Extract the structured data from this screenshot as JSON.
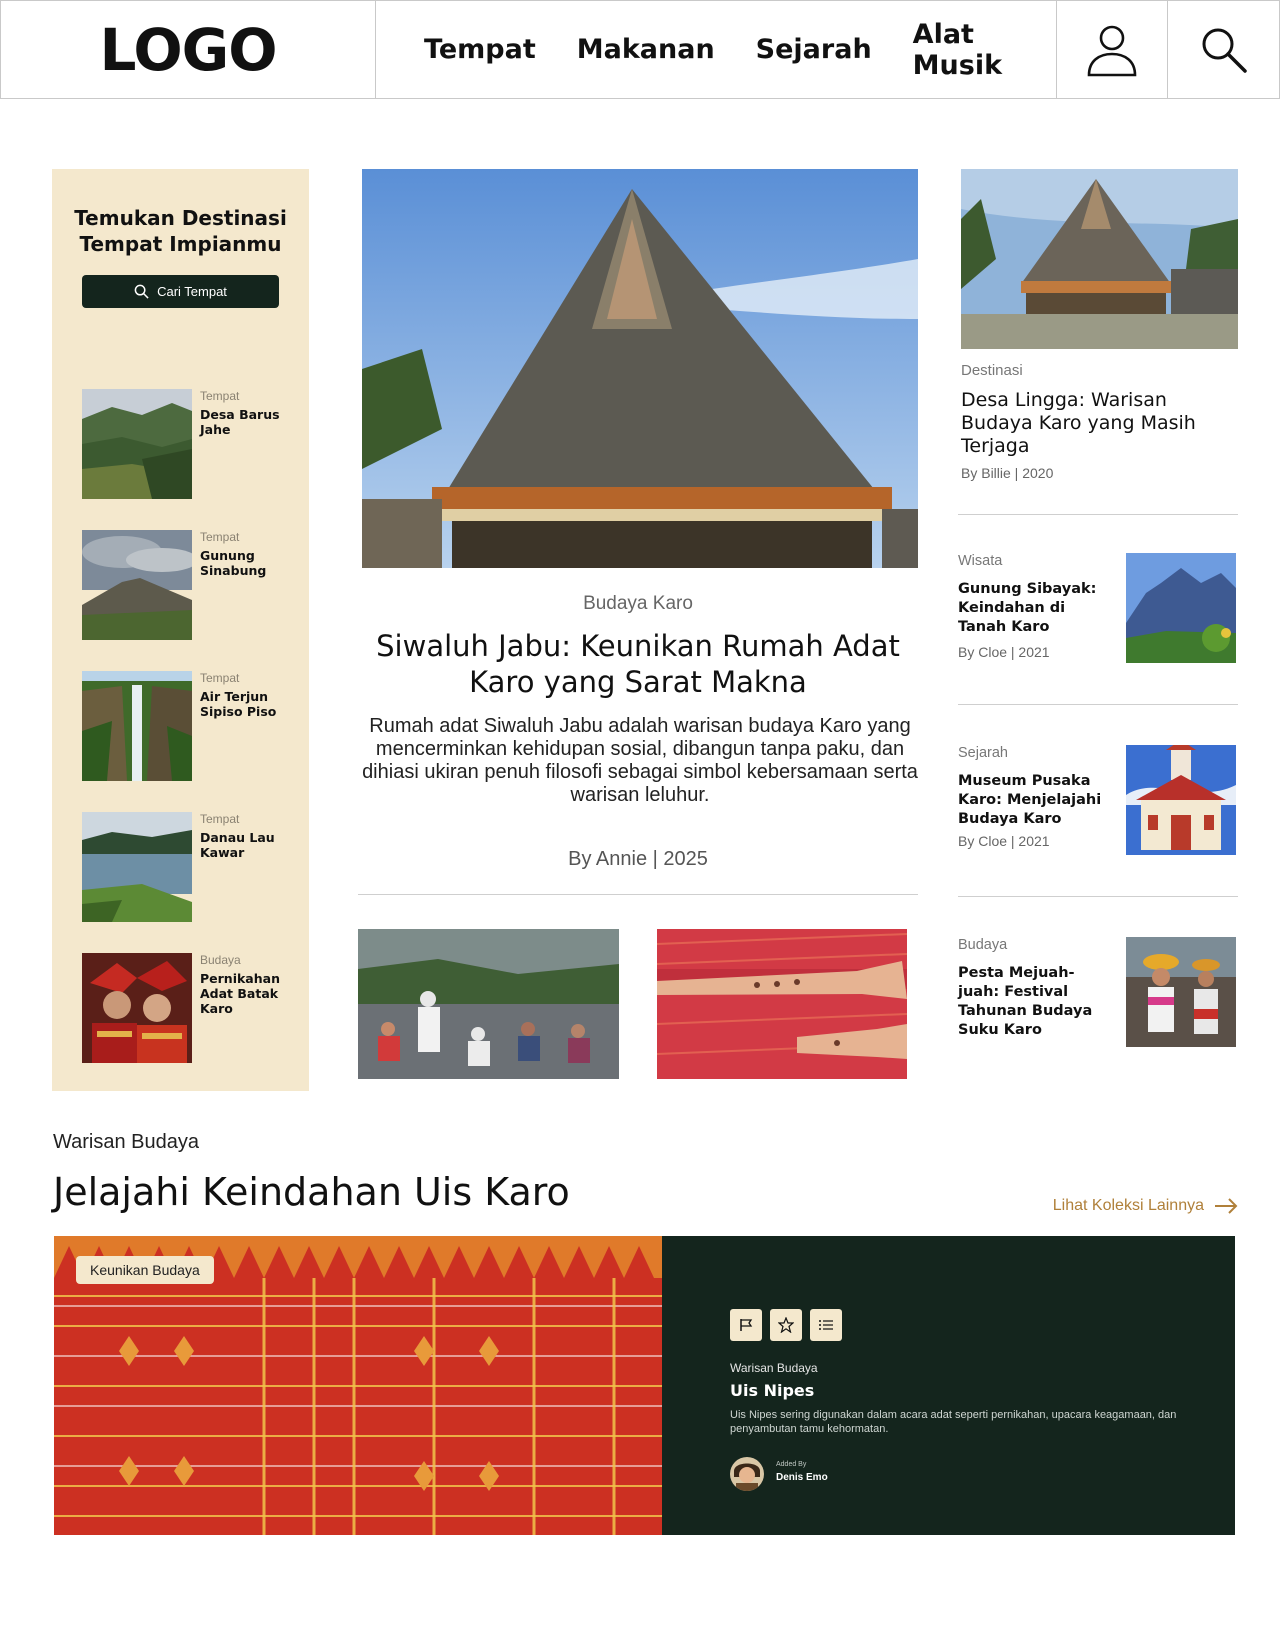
{
  "header": {
    "logo": "LOGO",
    "nav": [
      "Tempat",
      "Makanan",
      "Sejarah",
      "Alat Musik"
    ],
    "profile_icon": "user-icon",
    "search_icon": "search-icon"
  },
  "sidebar": {
    "title_line1": "Temukan Destinasi",
    "title_line2": "Tempat Impianmu",
    "button_label": "Cari Tempat",
    "items": [
      {
        "category": "Tempat",
        "name": "Desa Barus Jahe"
      },
      {
        "category": "Tempat",
        "name": "Gunung Sinabung"
      },
      {
        "category": "Tempat",
        "name": "Air Terjun Sipiso Piso"
      },
      {
        "category": "Tempat",
        "name": "Danau Lau Kawar"
      },
      {
        "category": "Budaya",
        "name": "Pernikahan Adat Batak Karo"
      }
    ]
  },
  "featured": {
    "category": "Budaya Karo",
    "title": "Siwaluh Jabu: Keunikan Rumah Adat Karo yang Sarat Makna",
    "description": "Rumah adat Siwaluh Jabu adalah warisan budaya Karo yang mencerminkan kehidupan sosial, dibangun tanpa paku, dan dihiasi ukiran penuh filosofi sebagai simbol kebersamaan serta warisan leluhur.",
    "byline": "By Annie | 2025"
  },
  "right": {
    "top": {
      "category": "Destinasi",
      "title": "Desa Lingga: Warisan Budaya Karo yang Masih Terjaga",
      "byline": "By Billie | 2020"
    },
    "items": [
      {
        "category": "Wisata",
        "title": "Gunung Sibayak: Keindahan di Tanah Karo",
        "byline": "By Cloe | 2021"
      },
      {
        "category": "Sejarah",
        "title": "Museum Pusaka Karo: Menjelajahi Budaya Karo",
        "byline": "By Cloe | 2021"
      },
      {
        "category": "Budaya",
        "title": "Pesta Mejuah-juah: Festival Tahunan Budaya Suku Karo",
        "byline": ""
      }
    ]
  },
  "warisan": {
    "label": "Warisan Budaya",
    "title": "Jelajahi Keindahan Uis Karo",
    "link": "Lihat Koleksi Lainnya",
    "badge": "Keunikan Budaya",
    "card_category": "Warisan Budaya",
    "card_name": "Uis Nipes",
    "card_desc": "Uis Nipes sering digunakan dalam acara adat seperti pernikahan, upacara keagamaan, dan penyambutan tamu kehormatan.",
    "added_by_label": "Added By",
    "author": "Denis Emo"
  }
}
